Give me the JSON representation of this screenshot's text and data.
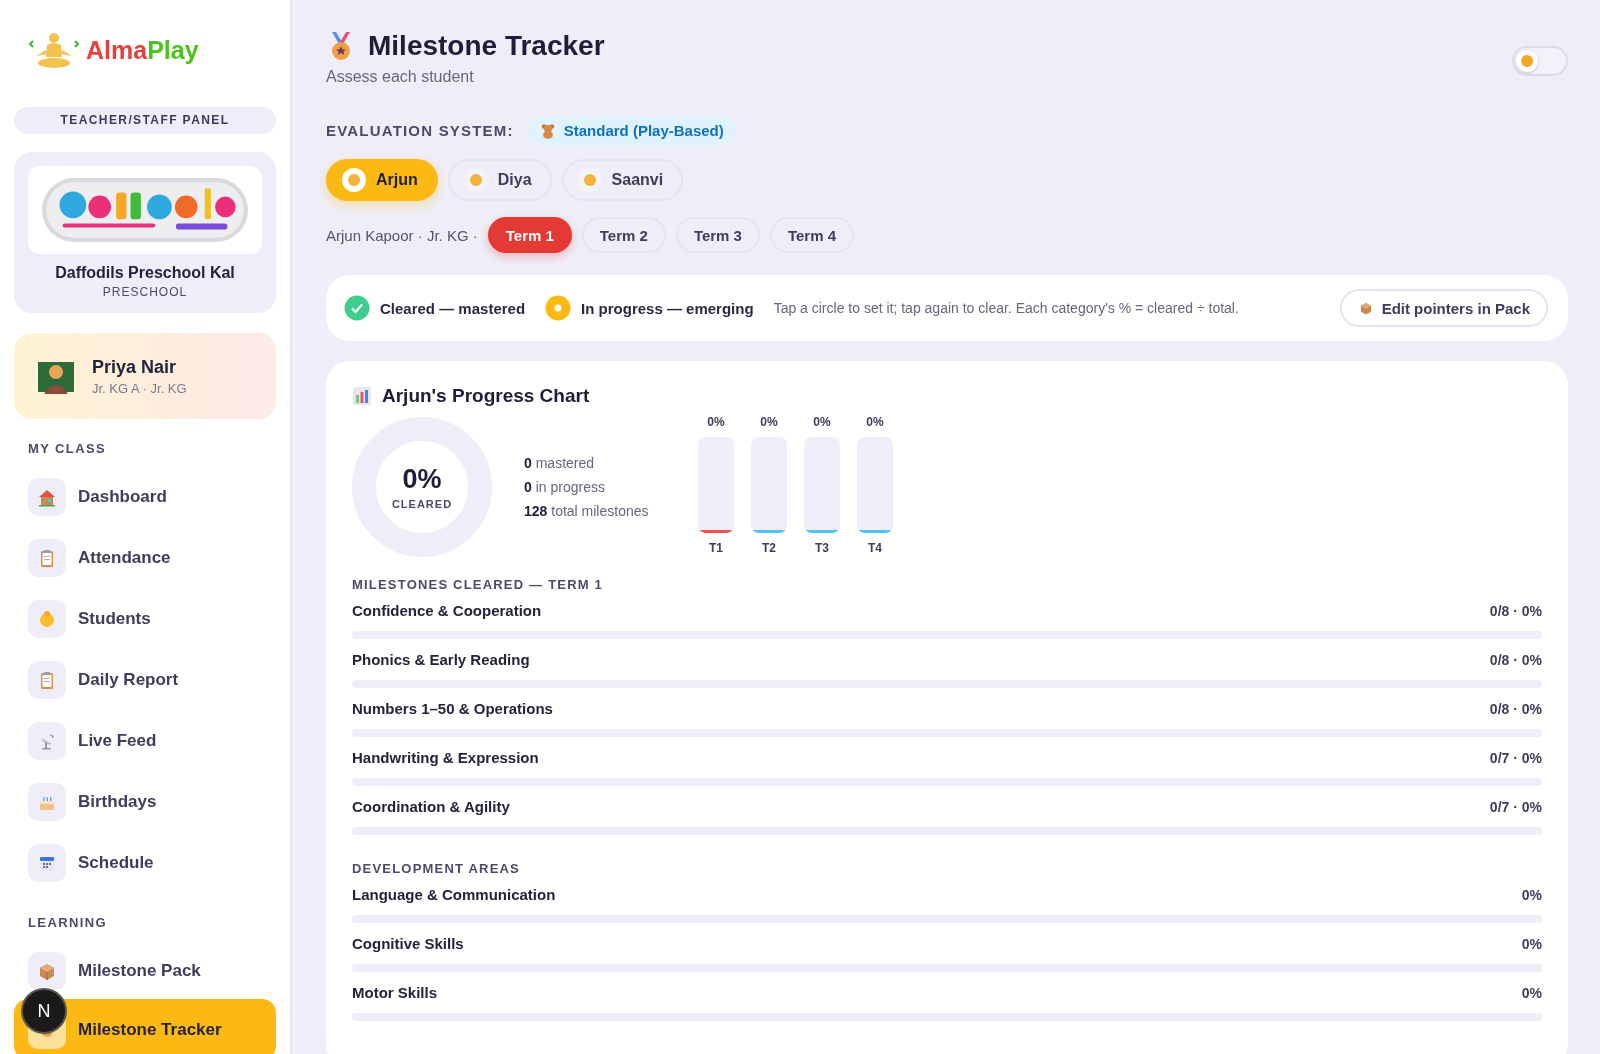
{
  "brand": {
    "name_parts": [
      "Alma",
      "Play"
    ]
  },
  "sidebar": {
    "panel_label": "TEACHER/STAFF PANEL",
    "school": {
      "name": "Daffodils Preschool Kal",
      "type": "PRESCHOOL"
    },
    "profile": {
      "name": "Priya Nair",
      "class": "Jr. KG A · Jr. KG"
    },
    "sections": [
      {
        "title": "MY CLASS",
        "items": [
          {
            "label": "Dashboard",
            "selected": false
          },
          {
            "label": "Attendance",
            "selected": false
          },
          {
            "label": "Students",
            "selected": false
          },
          {
            "label": "Daily Report",
            "selected": false
          },
          {
            "label": "Live Feed",
            "selected": false
          },
          {
            "label": "Birthdays",
            "selected": false
          },
          {
            "label": "Schedule",
            "selected": false
          }
        ]
      },
      {
        "title": "LEARNING",
        "items": [
          {
            "label": "Milestone Pack",
            "selected": false
          },
          {
            "label": "Milestone Tracker",
            "selected": true
          }
        ]
      }
    ]
  },
  "dev_indicator": {
    "label": "N"
  },
  "header": {
    "title": "Milestone Tracker",
    "subtitle": "Assess each student"
  },
  "theme_toggle": {
    "on": false
  },
  "evaluation": {
    "label": "EVALUATION SYSTEM:",
    "value": "Standard (Play-Based)"
  },
  "students": [
    {
      "name": "Arjun",
      "selected": true
    },
    {
      "name": "Diya",
      "selected": false
    },
    {
      "name": "Saanvi",
      "selected": false
    }
  ],
  "student_info": "Arjun Kapoor · Jr. KG ·",
  "terms": [
    {
      "label": "Term 1",
      "selected": true
    },
    {
      "label": "Term 2",
      "selected": false
    },
    {
      "label": "Term 3",
      "selected": false
    },
    {
      "label": "Term 4",
      "selected": false
    }
  ],
  "legend": {
    "items": [
      {
        "kind": "cleared",
        "label": "Cleared — mastered"
      },
      {
        "kind": "progress",
        "label": "In progress — emerging"
      }
    ],
    "hint": "Tap a circle to set it; tap again to clear. Each category's % = cleared ÷ total.",
    "button": "Edit pointers in Pack"
  },
  "progress": {
    "title": "Arjun's Progress Chart",
    "ring": {
      "value": "0%",
      "label": "CLEARED"
    },
    "stats": [
      "**0** mastered",
      "**0** in progress",
      "**128** total milestones"
    ],
    "term_bars": [
      {
        "reading": "0%",
        "label": "T1",
        "level": 0
      },
      {
        "reading": "0%",
        "label": "T2",
        "level": 0
      },
      {
        "reading": "0%",
        "label": "T3",
        "level": 0
      },
      {
        "reading": "0%",
        "label": "T4",
        "level": 0
      }
    ],
    "sections": [
      {
        "title": "MILESTONES CLEARED — TERM 1",
        "rows": [
          {
            "name": "Confidence & Cooperation",
            "reading": "0/8 · 0%"
          },
          {
            "name": "Phonics & Early Reading",
            "reading": "0/8 · 0%"
          },
          {
            "name": "Numbers 1–50 & Operations",
            "reading": "0/8 · 0%"
          },
          {
            "name": "Handwriting & Expression",
            "reading": "0/7 · 0%"
          },
          {
            "name": "Coordination & Agility",
            "reading": "0/7 · 0%"
          }
        ]
      },
      {
        "title": "DEVELOPMENT AREAS",
        "rows": [
          {
            "name": "Language & Communication",
            "reading": "0%"
          },
          {
            "name": "Cognitive Skills",
            "reading": "0%"
          },
          {
            "name": "Motor Skills",
            "reading": "0%"
          }
        ]
      }
    ]
  }
}
